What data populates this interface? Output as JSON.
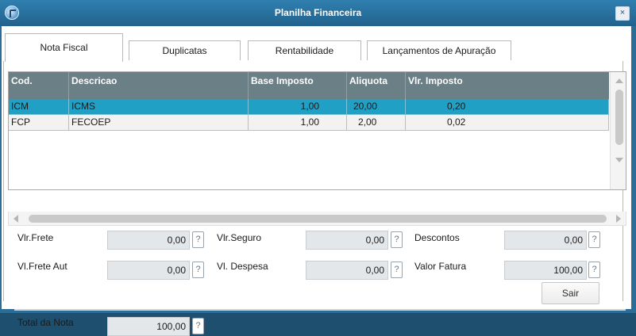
{
  "window": {
    "title": "Planilha Financeira",
    "close_label": "×"
  },
  "tabs": [
    {
      "label": "Nota Fiscal",
      "active": true
    },
    {
      "label": "Duplicatas"
    },
    {
      "label": "Rentabilidade"
    },
    {
      "label": "Lançamentos de Apuração"
    }
  ],
  "grid": {
    "columns": [
      "Cod.",
      "Descricao",
      "Base Imposto",
      "Aliquota",
      "Vlr. Imposto"
    ],
    "rows": [
      {
        "cod": "ICM",
        "descricao": "ICMS",
        "base": "1,00",
        "aliquota": "20,00",
        "valor": "0,20",
        "selected": true
      },
      {
        "cod": "FCP",
        "descricao": "FECOEP",
        "base": "1,00",
        "aliquota": "2,00",
        "valor": "0,02"
      }
    ]
  },
  "fields": {
    "vlr_frete": {
      "label": "Vlr.Frete",
      "value": "0,00"
    },
    "vlr_seguro": {
      "label": "Vlr.Seguro",
      "value": "0,00"
    },
    "descontos": {
      "label": "Descontos",
      "value": "0,00"
    },
    "vl_frete_aut": {
      "label": "Vl.Frete Aut",
      "value": "0,00"
    },
    "vl_despesa": {
      "label": "Vl. Despesa",
      "value": "0,00"
    },
    "valor_fatura": {
      "label": "Valor Fatura",
      "value": "100,00"
    },
    "total_nota": {
      "label": "Total da Nota",
      "value": "100,00"
    }
  },
  "help_label": "?",
  "buttons": {
    "sair": "Sair"
  }
}
